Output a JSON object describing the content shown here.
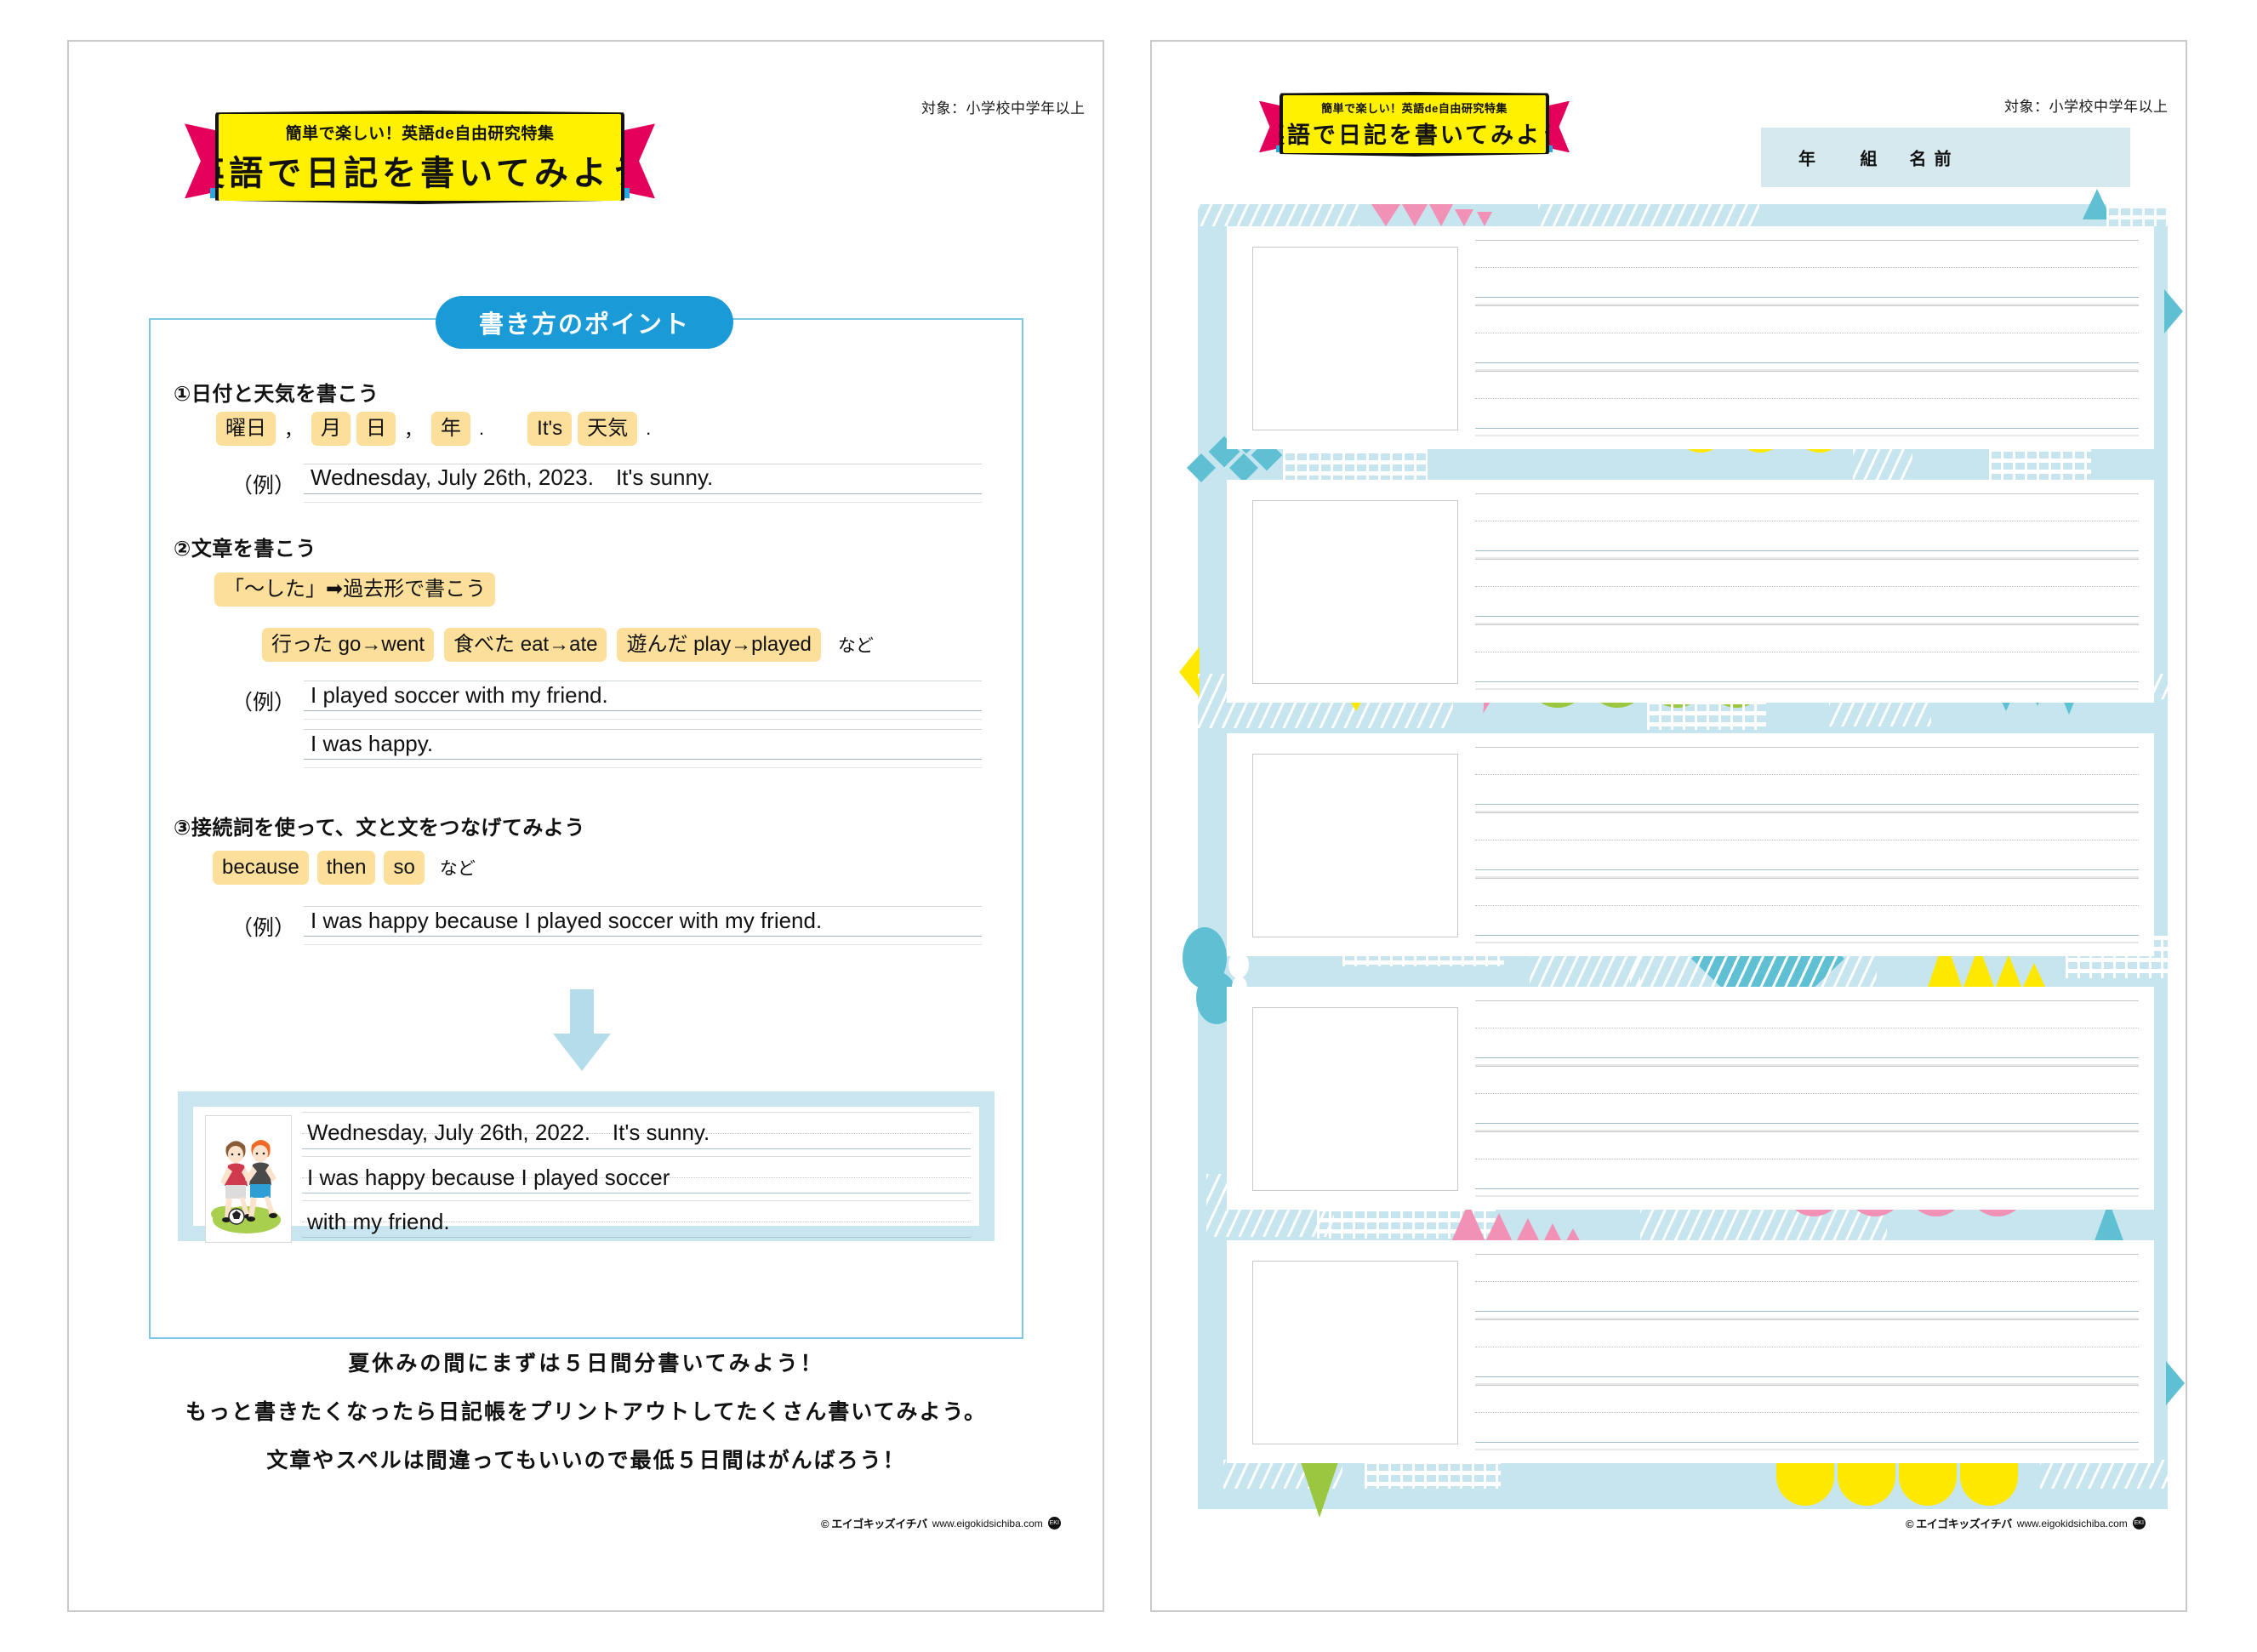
{
  "colors": {
    "ribbon_yellow": "#fff100",
    "ribbon_pink": "#e4005a",
    "ribbon_blue_tip": "#29a9e1",
    "pill_blue": "#1a9ad7",
    "point_box_border": "#7ec8e3",
    "chip_yellow": "#fcdf9a",
    "sample_frame": "#c9e6f0",
    "deco_light_blue": "#c7e5ef",
    "deco_teal": "#5fc0d4",
    "deco_pink": "#f191b5",
    "deco_yellow": "#ffe800",
    "deco_green": "#9ac73f",
    "name_box": "#d5e9ef",
    "page_border": "#c9c9cd",
    "text": "#111111"
  },
  "audience_note": "対象：小学校中学年以上",
  "banner": {
    "superline": "簡単で楽しい！英語de自由研究特集",
    "title": "英語で日記を書いてみよう"
  },
  "left_page": {
    "point_pill": "書き方のポイント",
    "sections": [
      {
        "heading": "①日付と天気を書こう",
        "chips": [
          {
            "type": "chip",
            "text": "曜日"
          },
          {
            "type": "plain",
            "text": "，"
          },
          {
            "type": "chip",
            "text": "月"
          },
          {
            "type": "chip",
            "text": "日"
          },
          {
            "type": "plain",
            "text": "，"
          },
          {
            "type": "chip",
            "text": "年"
          },
          {
            "type": "plain",
            "text": "."
          },
          {
            "type": "gap",
            "text": ""
          },
          {
            "type": "chip",
            "text": "It's"
          },
          {
            "type": "chip",
            "text": "天気"
          },
          {
            "type": "plain",
            "text": "."
          }
        ],
        "example_label": "（例）",
        "examples": [
          "Wednesday, July 26th, 2023.　It's sunny."
        ]
      },
      {
        "heading": "②文章を書こう",
        "rule_chip": "「～した」➡過去形で書こう",
        "verb_chips": [
          "行った go→went",
          "食べた eat→ate",
          "遊んだ play→played"
        ],
        "nado": "など",
        "example_label": "（例）",
        "examples": [
          "I played soccer with my friend.",
          "I was happy."
        ]
      },
      {
        "heading": "③接続詞を使って、文と文をつなげてみよう",
        "conj_chips": [
          "because",
          "then",
          "so"
        ],
        "nado": "など",
        "example_label": "（例）",
        "examples": [
          "I was happy because I played soccer with my friend."
        ]
      }
    ],
    "sample_diary": {
      "picture_alt": "two boys playing soccer illustration",
      "lines": [
        "Wednesday, July 26th, 2022.　It's sunny.",
        "I was happy because I played soccer",
        "with my friend."
      ]
    },
    "footer_messages": [
      "夏休みの間にまずは５日間分書いてみよう！",
      "もっと書きたくなったら日記帳をプリントアウトしてたくさん書いてみよう。",
      "文章やスペルは間違ってもいいので最低５日間はがんばろう！"
    ]
  },
  "right_page": {
    "name_box_label": "年　 組　名前",
    "entry_count": 5
  },
  "credit": {
    "logo": "© エイゴキッズイチバ",
    "url": "www.eigokidsichiba.com",
    "mark": "EKI"
  }
}
